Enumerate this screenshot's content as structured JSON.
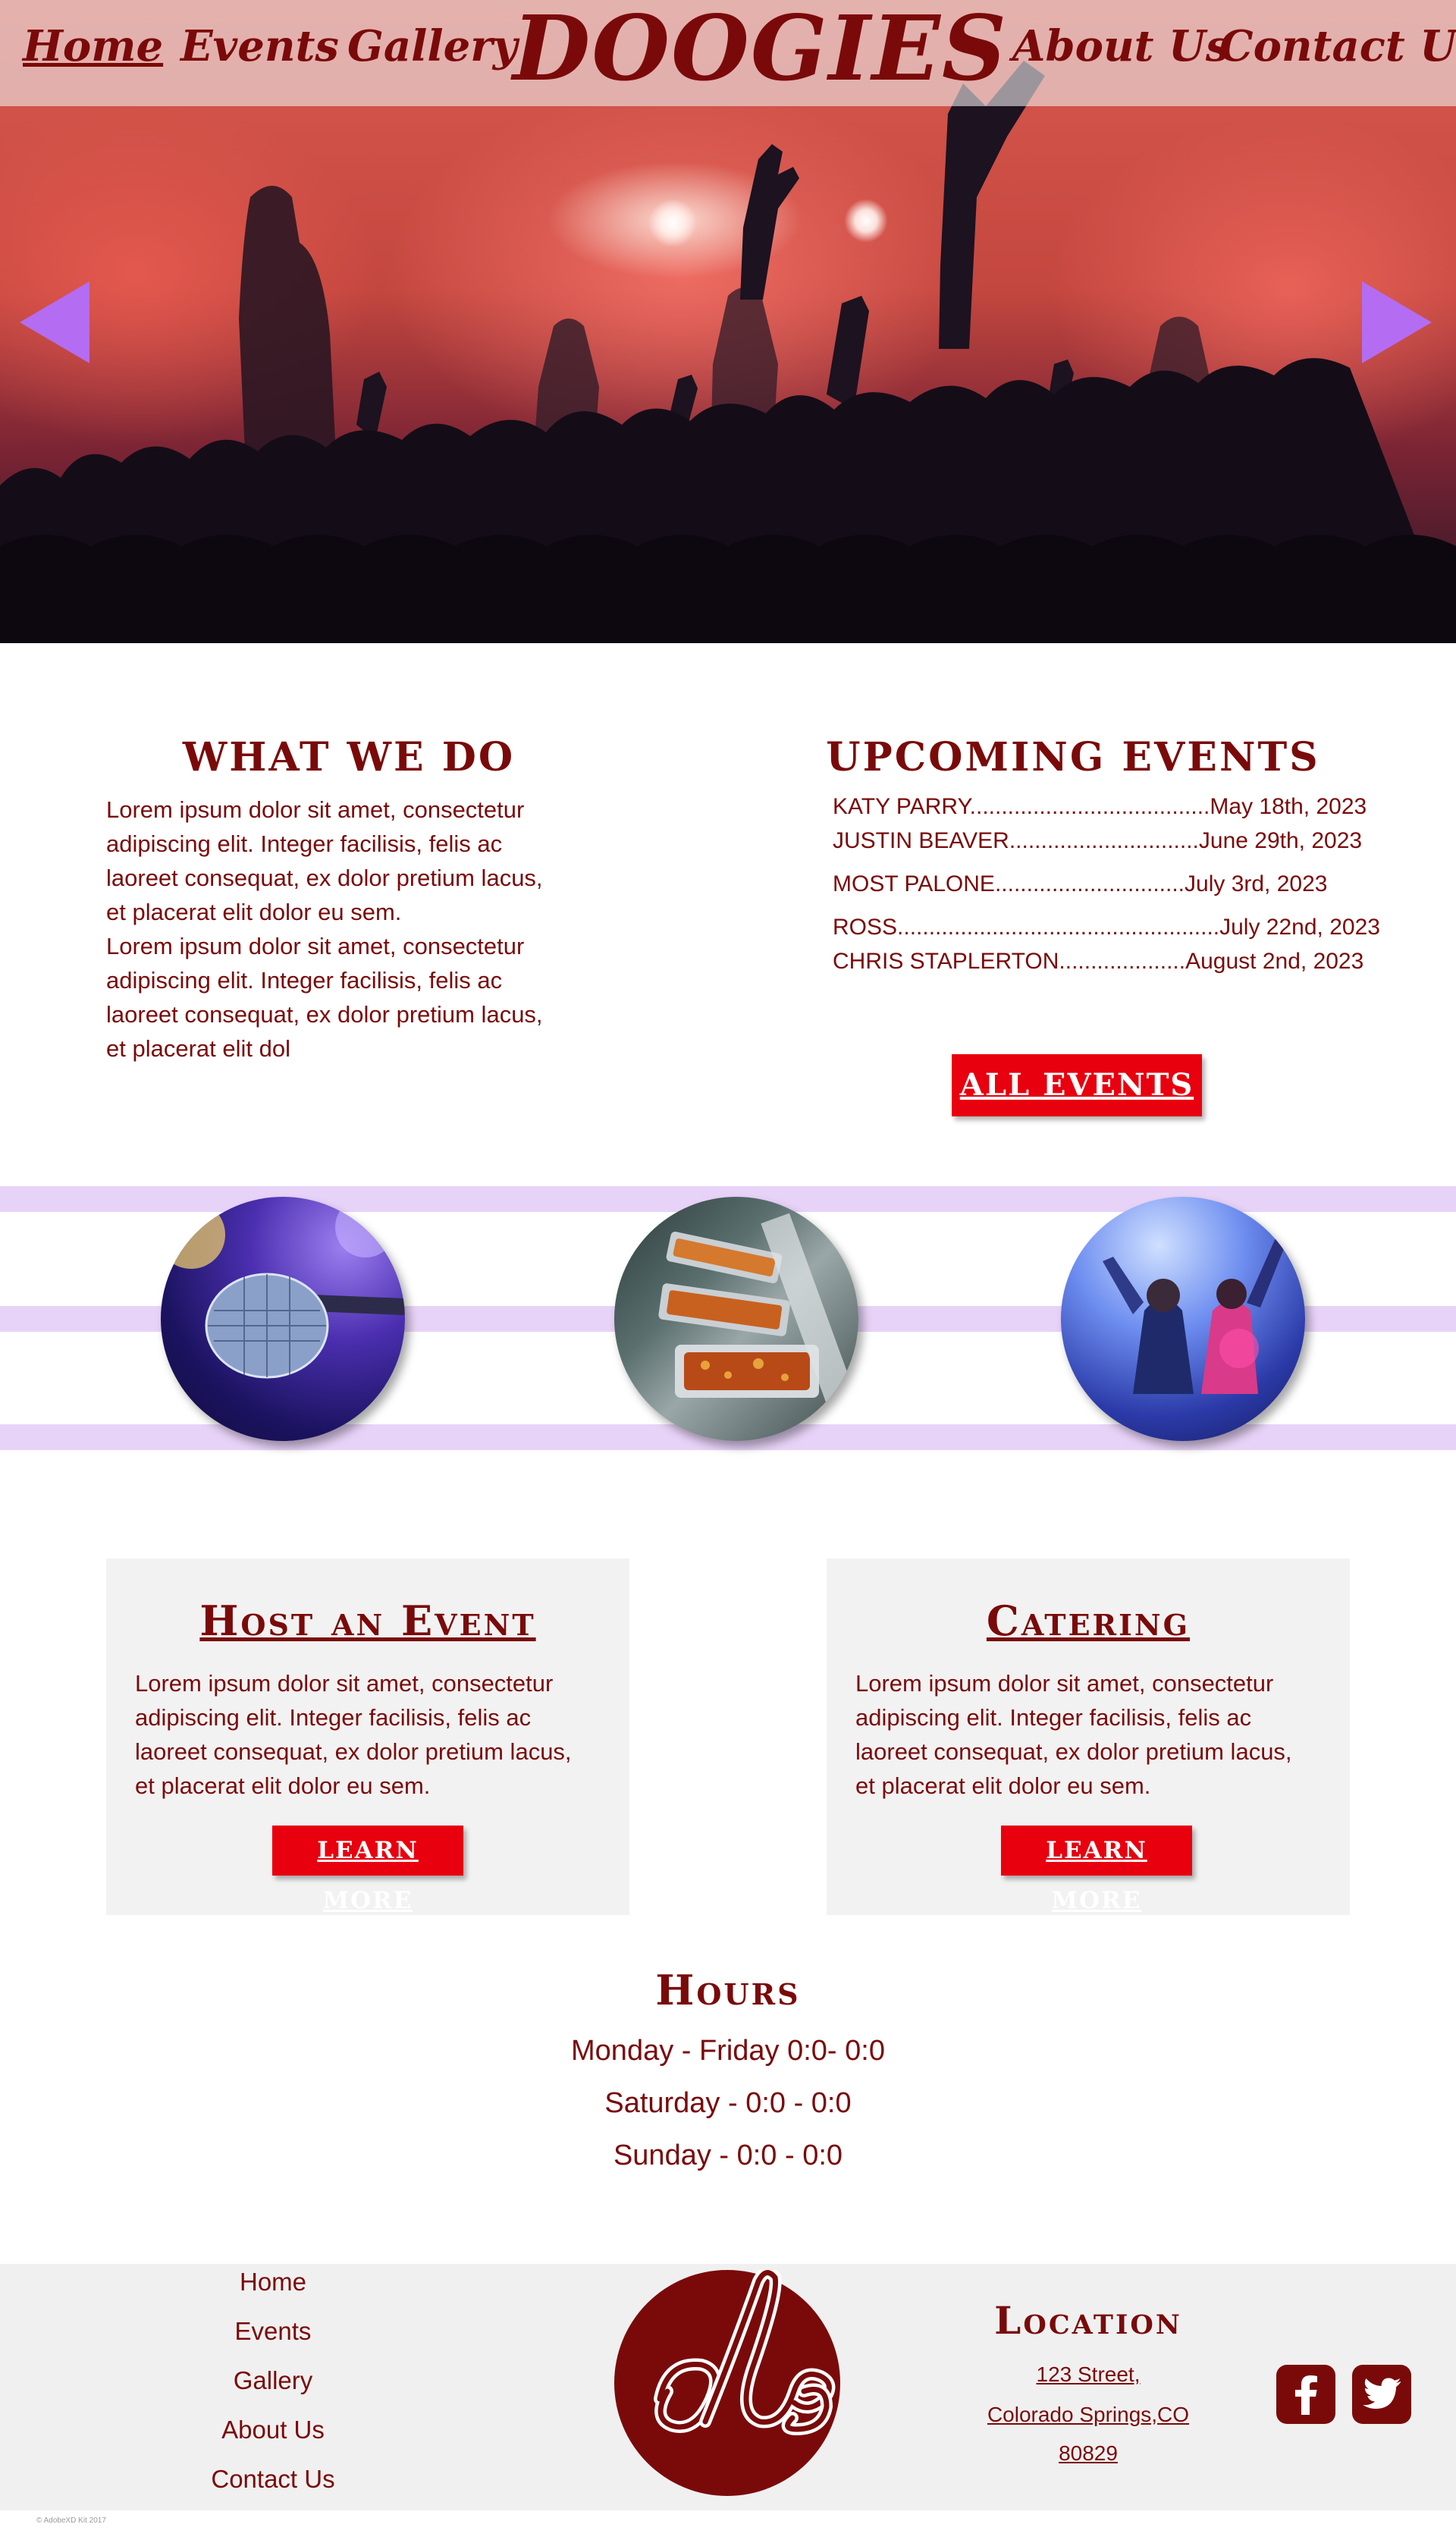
{
  "colors": {
    "brand": "#7a0a0a",
    "button": "#e8000e",
    "arrow": "#b46cf2",
    "stripe": "#e8d3f8",
    "card": "#f2f2f2"
  },
  "nav": {
    "home": "Home",
    "events": "Events",
    "gallery": "Gallery",
    "logo": "DOOGIES",
    "about": "About Us",
    "contact": "Contact Us"
  },
  "hero": {
    "left_arrow_icon": "triangle-left-icon",
    "right_arrow_icon": "triangle-right-icon"
  },
  "what_we_do": {
    "heading": "WHAT WE DO",
    "lines": [
      "Lorem ipsum dolor sit amet, consectetur",
      "adipiscing elit. Integer facilisis, felis ac",
      "laoreet consequat, ex dolor pretium lacus,",
      "et placerat elit dolor eu sem.",
      "Lorem ipsum dolor sit amet, consectetur",
      "adipiscing elit. Integer facilisis, felis ac",
      "laoreet consequat, ex dolor pretium lacus,",
      "et placerat elit dol"
    ]
  },
  "upcoming_events": {
    "heading": "UPCOMING EVENTS",
    "events": [
      {
        "name": "KATY PARRY",
        "dots": "......................................",
        "date": "May 18th, 2023"
      },
      {
        "name": "JUSTIN BEAVER",
        "dots": "..............................",
        "date": "June 29th, 2023"
      },
      {
        "name": "MOST PALONE",
        "dots": "..............................",
        "date": "July 3rd, 2023"
      },
      {
        "name": "ROSS",
        "dots": "...................................................",
        "date": "July 22nd, 2023"
      },
      {
        "name": "CHRIS STAPLERTON",
        "dots": "....................",
        "date": "August 2nd, 2023"
      }
    ],
    "button": "ALL EVENTS"
  },
  "features": {
    "images": [
      "microphone-photo",
      "catering-buffet-photo",
      "dancing-crowd-photo"
    ]
  },
  "host": {
    "heading": "Host an Event",
    "lines": [
      "Lorem ipsum dolor sit amet, consectetur",
      "adipiscing elit. Integer facilisis, felis ac",
      "laoreet consequat, ex dolor pretium lacus,",
      "et placerat elit dolor eu sem."
    ],
    "button": "LEARN MORE"
  },
  "catering": {
    "heading": "Catering",
    "lines": [
      "Lorem ipsum dolor sit amet, consectetur",
      "adipiscing elit. Integer facilisis, felis ac",
      "laoreet consequat, ex dolor pretium lacus,",
      "et placerat elit dolor eu sem."
    ],
    "button": "LEARN MORE"
  },
  "hours": {
    "heading": "Hours",
    "lines": [
      "Monday - Friday 0:0- 0:0",
      "Saturday - 0:0 - 0:0",
      "Sunday - 0:0 - 0:0"
    ]
  },
  "footer": {
    "links": [
      "Home",
      "Events",
      "Gallery",
      "About Us",
      "Contact Us"
    ],
    "logo_icon": "doogies-monogram-logo",
    "location_heading": "Location",
    "address": [
      "123 Street,",
      "Colorado Springs,CO",
      "80829"
    ],
    "social": [
      "facebook-icon",
      "twitter-icon"
    ],
    "copyright": "© AdobeXD Kit 2017"
  }
}
